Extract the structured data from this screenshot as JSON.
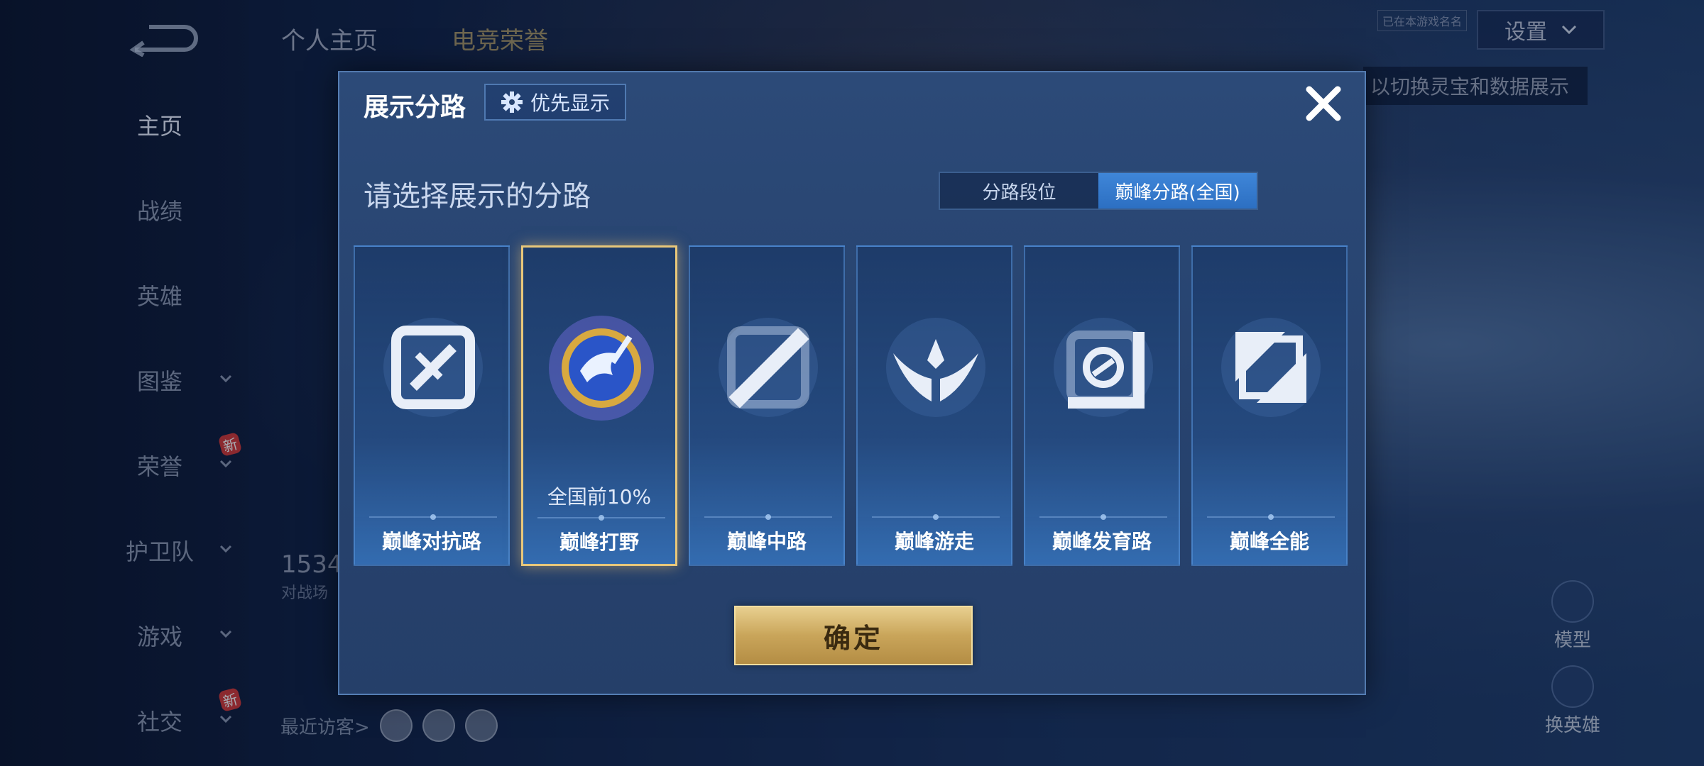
{
  "sidebar": {
    "items": [
      {
        "label": "主页",
        "active": true,
        "chevron": false,
        "badge": ""
      },
      {
        "label": "战绩",
        "active": false,
        "chevron": false,
        "badge": ""
      },
      {
        "label": "英雄",
        "active": false,
        "chevron": false,
        "badge": ""
      },
      {
        "label": "图鉴",
        "active": false,
        "chevron": true,
        "badge": ""
      },
      {
        "label": "荣誉",
        "active": false,
        "chevron": true,
        "badge": "新"
      },
      {
        "label": "护卫队",
        "active": false,
        "chevron": true,
        "badge": ""
      },
      {
        "label": "游戏",
        "active": false,
        "chevron": true,
        "badge": ""
      },
      {
        "label": "社交",
        "active": false,
        "chevron": true,
        "badge": "新"
      }
    ]
  },
  "background": {
    "tabs": [
      "个人主页",
      "电竞荣誉"
    ],
    "settings_label": "设置",
    "hint": "以切换灵宝和数据展示",
    "rec_label": "已在本游戏名名",
    "stat_number": "1534",
    "stat_sub": "对战场",
    "visitors_label": "最近访客>",
    "model_label": "模型",
    "switch_hero_label": "换英雄",
    "new_badge": "新"
  },
  "modal": {
    "title": "展示分路",
    "priority_label": "优先显示",
    "prompt": "请选择展示的分路",
    "segments": [
      {
        "label": "分路段位",
        "active": false
      },
      {
        "label": "巅峰分路(全国)",
        "active": true
      }
    ],
    "cards": [
      {
        "name": "巅峰对抗路",
        "icon": "sword-lane-icon",
        "rank": "",
        "selected": false
      },
      {
        "name": "巅峰打野",
        "icon": "dragon-jungle-emblem-icon",
        "rank": "全国前10%",
        "selected": true
      },
      {
        "name": "巅峰中路",
        "icon": "mid-lane-icon",
        "rank": "",
        "selected": false
      },
      {
        "name": "巅峰游走",
        "icon": "wings-roam-icon",
        "rank": "",
        "selected": false
      },
      {
        "name": "巅峰发育路",
        "icon": "farm-lane-icon",
        "rank": "",
        "selected": false
      },
      {
        "name": "巅峰全能",
        "icon": "all-round-icon",
        "rank": "",
        "selected": false
      }
    ],
    "confirm_label": "确定"
  },
  "colors": {
    "accent_gold": "#e8c77a",
    "segment_active": "#3f86d8",
    "modal_bg": "#27436f"
  }
}
